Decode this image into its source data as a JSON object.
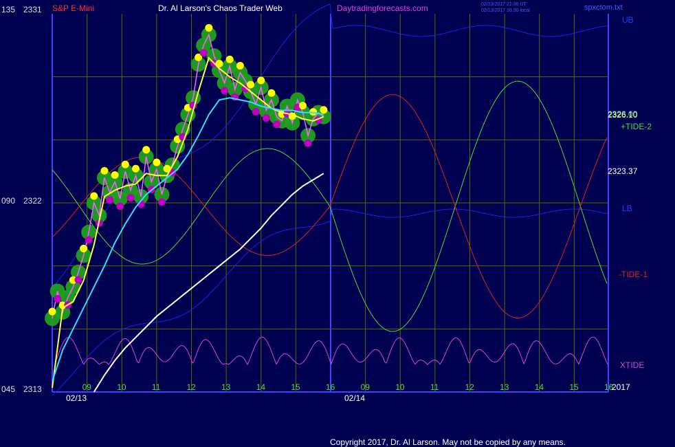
{
  "header": {
    "symbol": "S&P E-Mini",
    "title": "Dr. Al Larson's Chaos Trader Web",
    "site": "Daytradingforecasts.com",
    "stamp1": "02/13/2017 21:30 UT",
    "stamp2": "02/13/2017 16:30 local",
    "file": "spxctom.txt"
  },
  "left_axis": {
    "ticks": [
      {
        "angle": "135",
        "price": "2331"
      },
      {
        "angle": "090",
        "price": "2322"
      },
      {
        "angle": "045",
        "price": "2313"
      }
    ]
  },
  "x_axis": {
    "hours_day1": [
      "09",
      "10",
      "11",
      "12",
      "13",
      "14",
      "15",
      "16"
    ],
    "hours_day2": [
      "09",
      "10",
      "11",
      "12",
      "13",
      "14",
      "15",
      "16"
    ],
    "date1": "02/13",
    "date2": "02/14",
    "year": "2017"
  },
  "right_labels": {
    "ub": "UB",
    "lb": "LB",
    "tide2": "+TIDE-2",
    "tide1": "-TIDE-1",
    "xtide": "XTIDE",
    "price_a": "2326.00",
    "price_b": "2326.10",
    "price_c": "2323.37"
  },
  "footer": {
    "copyright": "Copyright 2017, Dr. Al Larson. May not be copied by any means."
  },
  "colors": {
    "background": "#000050",
    "grid": "#5a6a00",
    "axis": "#4040ff",
    "ema_fast": "#ffff40",
    "ema_slow": "#30e0ff",
    "ema_long": "#ffffff",
    "tide2": "#40e040",
    "tide1": "#e02020",
    "xtide": "#e040e0",
    "bands": "#2020e0",
    "highs": "#ffff00",
    "lows": "#c000c0",
    "cloud": "#20a020"
  },
  "chart_data": {
    "type": "line",
    "price_range": [
      2313,
      2331
    ],
    "series": [
      {
        "name": "S&P E-Mini",
        "x": [
          0.0,
          0.15,
          0.3,
          0.45,
          0.6,
          0.75,
          0.9,
          1.05,
          1.2,
          1.35,
          1.5,
          1.65,
          1.8,
          1.95,
          2.1,
          2.25,
          2.4,
          2.55,
          2.7,
          2.85,
          3.0,
          3.15,
          3.3,
          3.45,
          3.6,
          3.75,
          3.9,
          4.05,
          4.2,
          4.35,
          4.5,
          4.65,
          4.8,
          4.95,
          5.1,
          5.25,
          5.4,
          5.55,
          5.7,
          5.85,
          6.0,
          6.15,
          6.3,
          6.45,
          6.6,
          6.75,
          6.9,
          7.05,
          7.2,
          7.35,
          7.5,
          7.65,
          7.8
        ],
        "y": [
          2316.5,
          2317.8,
          2316.8,
          2317.5,
          2318.0,
          2318.7,
          2319.5,
          2320.6,
          2322.0,
          2321.4,
          2323.2,
          2322.5,
          2323.0,
          2322.2,
          2323.5,
          2322.6,
          2323.3,
          2322.3,
          2324.2,
          2323.0,
          2323.6,
          2322.4,
          2323.3,
          2323.8,
          2324.7,
          2325.5,
          2326.2,
          2327.0,
          2328.6,
          2329.5,
          2330.0,
          2329.0,
          2328.3,
          2327.7,
          2328.5,
          2327.4,
          2328.2,
          2327.8,
          2327.3,
          2326.7,
          2327.5,
          2326.4,
          2326.9,
          2326.1,
          2325.9,
          2326.6,
          2325.8,
          2326.9,
          2326.3,
          2325.2,
          2326.0,
          2326.3,
          2326.1
        ]
      },
      {
        "name": "",
        "x": [
          0.0,
          0.3,
          0.6,
          0.9,
          1.2,
          1.5,
          1.8,
          2.1,
          2.4,
          2.7,
          3.0,
          3.3,
          3.6,
          3.9,
          4.2,
          4.5,
          4.8,
          5.1,
          5.4,
          5.7,
          6.0,
          6.3,
          6.6,
          6.9,
          7.2,
          7.5,
          7.8
        ],
        "y": [
          2313.2,
          2317.0,
          2317.3,
          2318.3,
          2320.0,
          2322.3,
          2322.6,
          2322.8,
          2322.9,
          2323.4,
          2323.3,
          2323.3,
          2324.2,
          2325.5,
          2327.3,
          2328.9,
          2328.4,
          2328.0,
          2327.7,
          2327.3,
          2326.9,
          2326.5,
          2326.3,
          2326.2,
          2326.0,
          2325.9,
          2326.1
        ]
      },
      {
        "name": "",
        "x": [
          0.0,
          0.3,
          0.6,
          0.9,
          1.2,
          1.5,
          1.8,
          2.1,
          2.4,
          2.7,
          3.0,
          3.3,
          3.6,
          3.9,
          4.2,
          4.5,
          4.8,
          5.1,
          5.4,
          5.7,
          6.0,
          6.3,
          6.6,
          6.9,
          7.2,
          7.5,
          7.8
        ],
        "y": [
          2313.5,
          2315.0,
          2316.0,
          2317.0,
          2318.0,
          2319.0,
          2320.1,
          2321.0,
          2321.8,
          2322.4,
          2322.8,
          2323.2,
          2323.6,
          2324.3,
          2325.2,
          2326.2,
          2326.9,
          2327.0,
          2326.9,
          2326.8,
          2326.6,
          2326.5,
          2326.4,
          2326.4,
          2326.3,
          2326.3,
          2326.2
        ]
      },
      {
        "name": "",
        "x": [
          1.2,
          1.5,
          1.8,
          2.1,
          2.4,
          2.7,
          3.0,
          3.3,
          3.6,
          3.9,
          4.2,
          4.5,
          4.8,
          5.1,
          5.4,
          5.7,
          6.0,
          6.3,
          6.6,
          6.9,
          7.2,
          7.5,
          7.8
        ],
        "y": [
          2313.0,
          2313.8,
          2314.5,
          2315.1,
          2315.6,
          2316.1,
          2316.6,
          2317.0,
          2317.4,
          2317.8,
          2318.2,
          2318.6,
          2319.0,
          2319.4,
          2319.8,
          2320.3,
          2320.8,
          2321.4,
          2321.9,
          2322.4,
          2322.8,
          2323.1,
          2323.4
        ]
      }
    ]
  }
}
